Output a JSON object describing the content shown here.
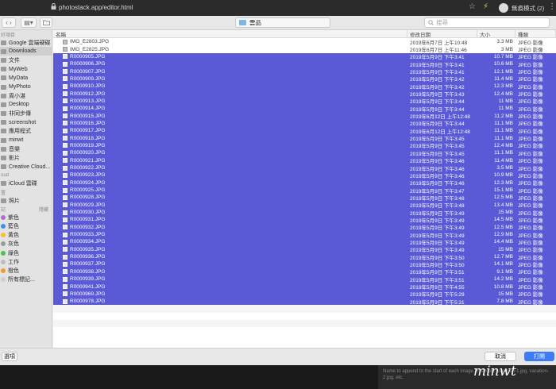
{
  "browser": {
    "url": "photostack.app/editor.html",
    "profile": "無痕模式 (2)"
  },
  "toolbar": {
    "folder": "雲品",
    "search_placeholder": "搜尋"
  },
  "sidebar": {
    "favorites_label": "好項目",
    "favorites": [
      "Google 雲端硬碟",
      "Downloads",
      "文件",
      "MyWeb",
      "MyData",
      "MyPhoto",
      "周小湛",
      "Desktop",
      "非同步傳",
      "screenshot",
      "應用程式",
      "minwt",
      "音樂",
      "影片",
      "Creative Cloud..."
    ],
    "icloud_label": "oud",
    "icloud": [
      "iCloud 雲碟"
    ],
    "locations_label": "置",
    "locations": [
      "照片"
    ],
    "tags_label": "記",
    "tags_remove": "隱藏",
    "tags": [
      {
        "label": "紫色",
        "color": "#b06ad9"
      },
      {
        "label": "藍色",
        "color": "#3d8ef0"
      },
      {
        "label": "黃色",
        "color": "#f2c230"
      },
      {
        "label": "灰色",
        "color": "#9b9b9b"
      },
      {
        "label": "綠色",
        "color": "#4cc24c"
      },
      {
        "label": "工作",
        "color": "#bdbdbd"
      },
      {
        "label": "橙色",
        "color": "#f29a2e"
      },
      {
        "label": "所有標記...",
        "color": "#cfcfcf"
      }
    ]
  },
  "columns": {
    "name": "名稱",
    "date": "修改日期",
    "size": "大小",
    "kind": "種類"
  },
  "files": [
    {
      "name": "IMG_E2803.JPG",
      "date": "2019年6月7日 上午10:48",
      "size": "3.3 MB",
      "kind": "JPEG 影像",
      "selected": false
    },
    {
      "name": "IMG_E2825.JPG",
      "date": "2019年6月7日 上午11:46",
      "size": "3 MB",
      "kind": "JPEG 影像",
      "selected": false
    },
    {
      "name": "R0000905.JPG",
      "date": "2019年5月9日 下午3:41",
      "size": "10.7 MB",
      "kind": "JPEG 影像",
      "selected": true
    },
    {
      "name": "R0000906.JPG",
      "date": "2019年5月9日 下午3:41",
      "size": "10.6 MB",
      "kind": "JPEG 影像",
      "selected": true
    },
    {
      "name": "R0000907.JPG",
      "date": "2019年5月9日 下午3:41",
      "size": "12.1 MB",
      "kind": "JPEG 影像",
      "selected": true
    },
    {
      "name": "R0000909.JPG",
      "date": "2019年5月9日 下午3:42",
      "size": "11.4 MB",
      "kind": "JPEG 影像",
      "selected": true
    },
    {
      "name": "R0000910.JPG",
      "date": "2019年5月9日 下午3:42",
      "size": "12.3 MB",
      "kind": "JPEG 影像",
      "selected": true
    },
    {
      "name": "R0000912.JPG",
      "date": "2019年5月9日 下午3:43",
      "size": "12.4 MB",
      "kind": "JPEG 影像",
      "selected": true
    },
    {
      "name": "R0000913.JPG",
      "date": "2019年5月9日 下午3:44",
      "size": "11 MB",
      "kind": "JPEG 影像",
      "selected": true
    },
    {
      "name": "R0000914.JPG",
      "date": "2019年5月9日 下午3:44",
      "size": "11 MB",
      "kind": "JPEG 影像",
      "selected": true
    },
    {
      "name": "R0000915.JPG",
      "date": "2019年6月12日 上午12:48",
      "size": "11.2 MB",
      "kind": "JPEG 影像",
      "selected": true
    },
    {
      "name": "R0000916.JPG",
      "date": "2019年5月9日 下午3:44",
      "size": "11.1 MB",
      "kind": "JPEG 影像",
      "selected": true
    },
    {
      "name": "R0000917.JPG",
      "date": "2019年6月12日 上午12:48",
      "size": "11.1 MB",
      "kind": "JPEG 影像",
      "selected": true
    },
    {
      "name": "R0000918.JPG",
      "date": "2019年5月9日 下午3:45",
      "size": "11.1 MB",
      "kind": "JPEG 影像",
      "selected": true
    },
    {
      "name": "R0000919.JPG",
      "date": "2019年5月9日 下午3:45",
      "size": "12.4 MB",
      "kind": "JPEG 影像",
      "selected": true
    },
    {
      "name": "R0000920.JPG",
      "date": "2019年5月9日 下午3:45",
      "size": "11.1 MB",
      "kind": "JPEG 影像",
      "selected": true
    },
    {
      "name": "R0000921.JPG",
      "date": "2019年5月9日 下午3:46",
      "size": "11.4 MB",
      "kind": "JPEG 影像",
      "selected": true
    },
    {
      "name": "R0000922.JPG",
      "date": "2019年5月9日 下午3:46",
      "size": "3.5 MB",
      "kind": "JPEG 影像",
      "selected": true
    },
    {
      "name": "R0000923.JPG",
      "date": "2019年5月9日 下午3:46",
      "size": "10.9 MB",
      "kind": "JPEG 影像",
      "selected": true
    },
    {
      "name": "R0000924.JPG",
      "date": "2019年5月9日 下午3:46",
      "size": "12.3 MB",
      "kind": "JPEG 影像",
      "selected": true
    },
    {
      "name": "R0000925.JPG",
      "date": "2019年5月9日 下午3:47",
      "size": "15.1 MB",
      "kind": "JPEG 影像",
      "selected": true
    },
    {
      "name": "R0000928.JPG",
      "date": "2019年5月9日 下午3:48",
      "size": "12.5 MB",
      "kind": "JPEG 影像",
      "selected": true
    },
    {
      "name": "R0000929.JPG",
      "date": "2019年5月9日 下午3:48",
      "size": "13.4 MB",
      "kind": "JPEG 影像",
      "selected": true
    },
    {
      "name": "R0000930.JPG",
      "date": "2019年5月9日 下午3:49",
      "size": "15 MB",
      "kind": "JPEG 影像",
      "selected": true
    },
    {
      "name": "R0000931.JPG",
      "date": "2019年5月9日 下午3:49",
      "size": "14.5 MB",
      "kind": "JPEG 影像",
      "selected": true
    },
    {
      "name": "R0000932.JPG",
      "date": "2019年5月9日 下午3:49",
      "size": "12.5 MB",
      "kind": "JPEG 影像",
      "selected": true
    },
    {
      "name": "R0000933.JPG",
      "date": "2019年5月9日 下午3:49",
      "size": "12.9 MB",
      "kind": "JPEG 影像",
      "selected": true
    },
    {
      "name": "R0000934.JPG",
      "date": "2019年5月9日 下午3:49",
      "size": "14.4 MB",
      "kind": "JPEG 影像",
      "selected": true
    },
    {
      "name": "R0000935.JPG",
      "date": "2019年5月9日 下午3:49",
      "size": "15 MB",
      "kind": "JPEG 影像",
      "selected": true
    },
    {
      "name": "R0000936.JPG",
      "date": "2019年5月9日 下午3:50",
      "size": "12.7 MB",
      "kind": "JPEG 影像",
      "selected": true
    },
    {
      "name": "R0000937.JPG",
      "date": "2019年5月9日 下午3:50",
      "size": "14.1 MB",
      "kind": "JPEG 影像",
      "selected": true
    },
    {
      "name": "R0000938.JPG",
      "date": "2019年5月9日 下午3:51",
      "size": "9.1 MB",
      "kind": "JPEG 影像",
      "selected": true
    },
    {
      "name": "R0000939.JPG",
      "date": "2019年5月9日 下午3:51",
      "size": "14.2 MB",
      "kind": "JPEG 影像",
      "selected": true
    },
    {
      "name": "R0000941.JPG",
      "date": "2019年5月9日 下午4:55",
      "size": "10.8 MB",
      "kind": "JPEG 影像",
      "selected": true
    },
    {
      "name": "R0000969.JPG",
      "date": "2019年5月9日 下午5:29",
      "size": "15 MB",
      "kind": "JPEG 影像",
      "selected": true
    },
    {
      "name": "R0000978.JPG",
      "date": "2019年5月9日 下午5:31",
      "size": "7.8 MB",
      "kind": "JPEG 影像",
      "selected": true
    }
  ],
  "footer": {
    "options": "選項",
    "cancel": "取消",
    "open": "打開"
  },
  "hint": "Name to append to the start of each image. Example: vacation-1.jpg, vacation-2.jpg, etc.",
  "watermark": "minwt"
}
